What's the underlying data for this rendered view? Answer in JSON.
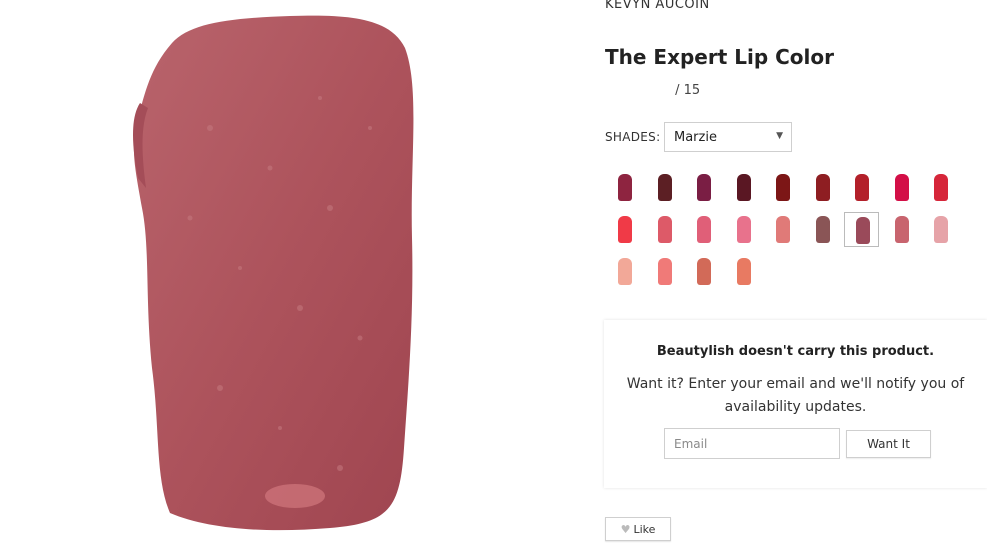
{
  "product": {
    "brand": "KEVYN AUCOIN",
    "name": "The Expert Lip Color",
    "rating_suffix": "/ 15"
  },
  "shades": {
    "label": "SHADES:",
    "selected": "Marzie",
    "swatches": [
      {
        "color": "#8e2440"
      },
      {
        "color": "#5c1f24"
      },
      {
        "color": "#7a1e44"
      },
      {
        "color": "#5a1723"
      },
      {
        "color": "#7c1616"
      },
      {
        "color": "#8e1e22"
      },
      {
        "color": "#b3202a"
      },
      {
        "color": "#d30f47"
      },
      {
        "color": "#d6263a"
      },
      {
        "color": "#f03a47"
      },
      {
        "color": "#dd5a68"
      },
      {
        "color": "#e05f78"
      },
      {
        "color": "#e8728c"
      },
      {
        "color": "#e07a78"
      },
      {
        "color": "#8a5556"
      },
      {
        "color": "#9a4a5a",
        "selected": true
      },
      {
        "color": "#c8646e"
      },
      {
        "color": "#e6a3a8"
      },
      {
        "color": "#f2a898"
      },
      {
        "color": "#f07a78"
      },
      {
        "color": "#d26a58"
      },
      {
        "color": "#e87a62"
      }
    ]
  },
  "notify": {
    "title": "Beautylish doesn't carry this product.",
    "text": "Want it? Enter your email and we'll notify you of availability updates.",
    "email_placeholder": "Email",
    "button_label": "Want It"
  },
  "like": {
    "label": "Like"
  },
  "colors": {
    "swatch_main": "#b25a63",
    "swatch_dark": "#8e3a45"
  }
}
